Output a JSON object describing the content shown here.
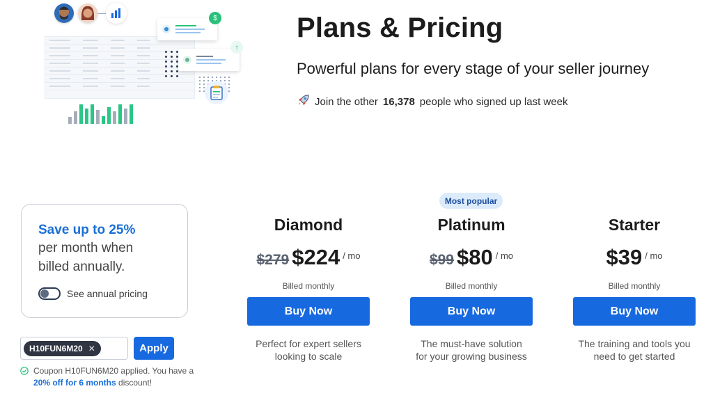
{
  "header": {
    "title": "Plans & Pricing",
    "subtitle": "Powerful plans for every stage of your seller journey",
    "signup_prefix": "Join the other",
    "signup_count": "16,378",
    "signup_suffix": "people who signed up last week",
    "signup_icon": "rocket-icon"
  },
  "annual": {
    "headline": "Save up to 25%",
    "body": "per month when billed annually.",
    "toggle_label": "See annual pricing",
    "toggle_on": false
  },
  "coupon": {
    "code": "H10FUN6M20",
    "apply_label": "Apply",
    "status_prefix": "Coupon H10FUN6M20 applied. You have a",
    "status_highlight": "20% off for 6 months",
    "status_suffix": "discount!"
  },
  "badge": {
    "popular": "Most popular"
  },
  "plans": [
    {
      "name": "Diamond",
      "old_price": "$279",
      "price": "$224",
      "period": "/ mo",
      "billed": "Billed monthly",
      "button": "Buy Now",
      "description": "Perfect for expert sellers looking to scale"
    },
    {
      "name": "Platinum",
      "old_price": "$99",
      "price": "$80",
      "period": "/ mo",
      "billed": "Billed monthly",
      "button": "Buy Now",
      "description": "The must-have solution for your growing business"
    },
    {
      "name": "Starter",
      "old_price": "",
      "price": "$39",
      "period": "/ mo",
      "billed": "Billed monthly",
      "button": "Buy Now",
      "description": "The training and tools you need to get started"
    }
  ],
  "colors": {
    "accent": "#1769e0",
    "headline_blue": "#1a6fd8",
    "badge_bg": "#dcebfb",
    "success": "#28c27a"
  }
}
